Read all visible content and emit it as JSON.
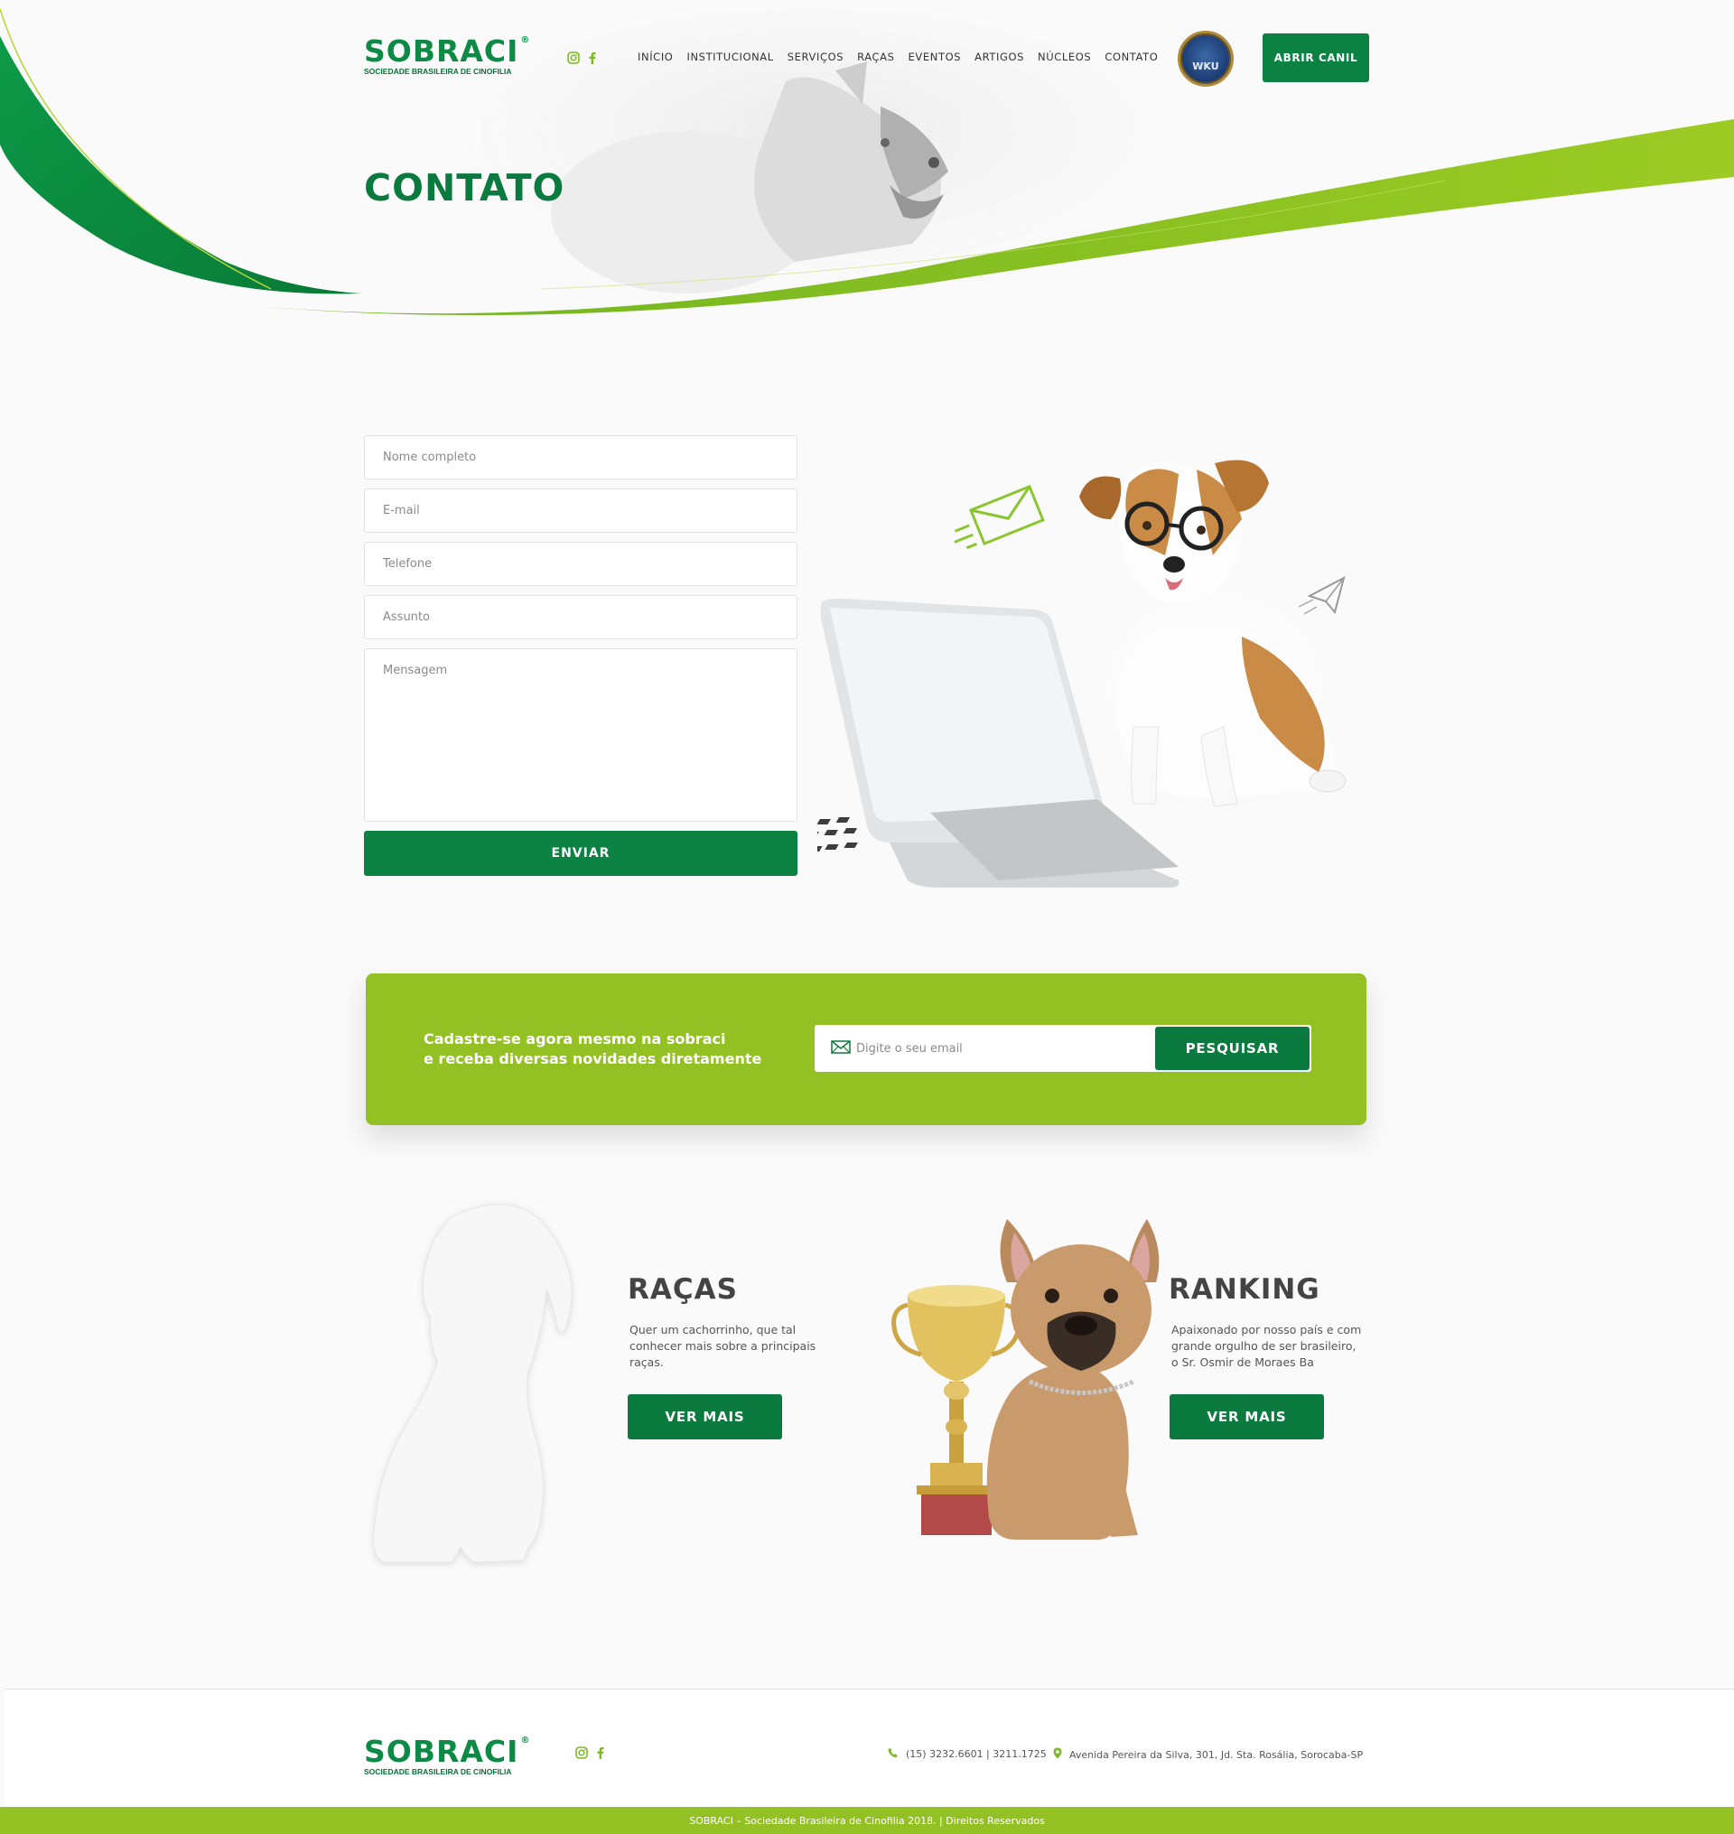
{
  "brand": {
    "name": "SOBRACI",
    "subtitle": "SOCIEDADE BRASILEIRA DE CINOFILIA",
    "registered": "®"
  },
  "social": [
    {
      "icon": "instagram-icon"
    },
    {
      "icon": "facebook-icon"
    }
  ],
  "nav": {
    "items": [
      "INÍCIO",
      "INSTITUCIONAL",
      "SERVIÇOS",
      "RAÇAS",
      "EVENTOS",
      "ARTIGOS",
      "NÚCLEOS",
      "CONTATO"
    ]
  },
  "header": {
    "badge_text": "WKU",
    "cta_label": "ABRIR CANIL",
    "page_title": "CONTATO"
  },
  "form": {
    "name_placeholder": "Nome completo",
    "email_placeholder": "E-mail",
    "phone_placeholder": "Telefone",
    "subject_placeholder": "Assunto",
    "message_placeholder": "Mensagem",
    "submit_label": "ENVIAR"
  },
  "newsletter": {
    "line1": "Cadastre-se agora mesmo na sobraci",
    "line2": "e receba diversas novidades diretamente",
    "placeholder": "Digite o seu email",
    "button_label": "PESQUISAR"
  },
  "features": [
    {
      "title": "RAÇAS",
      "text_lines": [
        "Quer um cachorrinho, que tal",
        "conhecer mais sobre a principais",
        "raças."
      ],
      "button": "VER MAIS"
    },
    {
      "title": "RANKING",
      "text_lines": [
        "Apaixonado por nosso país e com",
        "grande orgulho de ser brasileiro,",
        "o Sr. Osmir de Moraes Ba"
      ],
      "button": "VER MAIS"
    }
  ],
  "footer": {
    "phone": "(15) 3232.6601 | 3211.1725",
    "address": "Avenida Pereira da Silva, 301, Jd. Sta. Rosália, Sorocaba-SP",
    "copyright": "SOBRACI – Sociedade Brasileira de Cinofilia 2018. | Direitos Reservados"
  },
  "colors": {
    "primary_green": "#0b8142",
    "lime_green": "#93c123",
    "title_green": "#0b7a3e"
  }
}
